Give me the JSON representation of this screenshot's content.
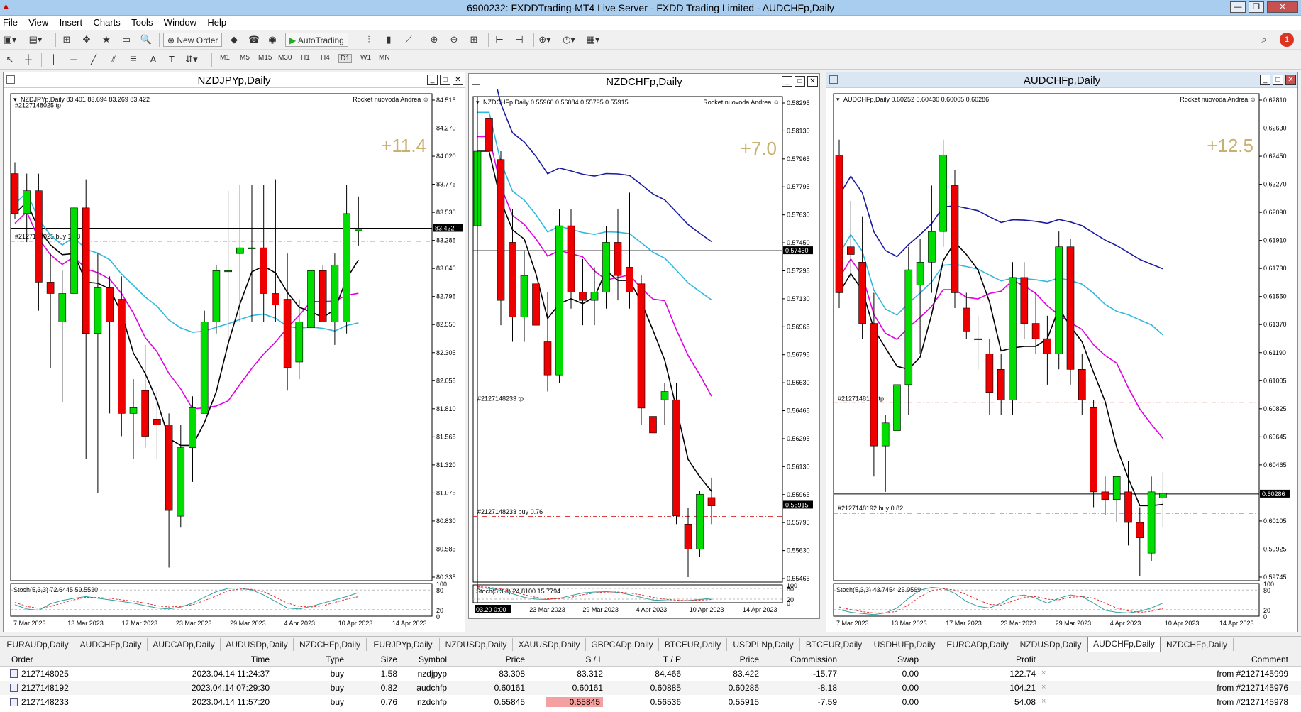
{
  "window": {
    "title": "6900232: FXDDTrading-MT4 Live Server - FXDD Trading Limited - AUDCHFp,Daily",
    "app_icon": "mt4-icon",
    "minimize_label": "—",
    "restore_label": "❐",
    "close_label": "✕"
  },
  "menu": [
    "File",
    "View",
    "Insert",
    "Charts",
    "Tools",
    "Window",
    "Help"
  ],
  "toolbar": {
    "new_order_label": "New Order",
    "autotrading_label": "AutoTrading",
    "alert_count": "1",
    "timeframes": [
      "M1",
      "M5",
      "M15",
      "M30",
      "H1",
      "H4",
      "D1",
      "W1",
      "MN"
    ],
    "selected_timeframe": "D1"
  },
  "charts": [
    {
      "id": "nzdjpy",
      "title": "NZDJPYp,Daily",
      "ohlc_label": "NZDJPYp,Daily  83.401 83.694 83.269 83.422",
      "ea_label": "Rocket nuovoda Andrea ☺",
      "pips_label": "+11.4",
      "tp_label": "#2127148025 tp",
      "buy_label": "#2127148025 buy 1.58",
      "current_price_label": "83.422",
      "price_ticks": [
        "84.515",
        "84.270",
        "84.020",
        "83.775",
        "83.530",
        "83.285",
        "83.040",
        "82.795",
        "82.550",
        "82.305",
        "82.055",
        "81.810",
        "81.565",
        "81.320",
        "81.075",
        "80.830",
        "80.585",
        "80.335"
      ],
      "stoch_label": "Stoch(5,3,3) 72.6445 59.5530",
      "stoch_ticks": [
        "100",
        "80",
        "20",
        "0"
      ],
      "date_ticks": [
        "7 Mar 2023",
        "13 Mar 2023",
        "17 Mar 2023",
        "23 Mar 2023",
        "29 Mar 2023",
        "4 Apr 2023",
        "10 Apr 2023",
        "14 Apr 2023"
      ],
      "chart_data": {
        "type": "candlestick",
        "ylim": [
          80.335,
          84.6
        ],
        "candles": [
          {
            "o": 83.9,
            "h": 84.0,
            "l": 83.5,
            "c": 83.55
          },
          {
            "o": 83.55,
            "h": 83.9,
            "l": 83.3,
            "c": 83.75
          },
          {
            "o": 83.75,
            "h": 83.9,
            "l": 82.7,
            "c": 82.95
          },
          {
            "o": 82.95,
            "h": 83.2,
            "l": 82.2,
            "c": 82.85
          },
          {
            "o": 82.6,
            "h": 83.05,
            "l": 81.9,
            "c": 82.85
          },
          {
            "o": 82.85,
            "h": 84.05,
            "l": 81.7,
            "c": 83.6
          },
          {
            "o": 83.6,
            "h": 83.85,
            "l": 81.4,
            "c": 82.5
          },
          {
            "o": 82.5,
            "h": 83.2,
            "l": 81.1,
            "c": 82.9
          },
          {
            "o": 82.9,
            "h": 83.0,
            "l": 81.8,
            "c": 82.6
          },
          {
            "o": 82.8,
            "h": 83.0,
            "l": 81.6,
            "c": 81.8
          },
          {
            "o": 81.8,
            "h": 82.1,
            "l": 81.4,
            "c": 81.85
          },
          {
            "o": 82.0,
            "h": 82.4,
            "l": 81.5,
            "c": 81.6
          },
          {
            "o": 81.75,
            "h": 82.0,
            "l": 81.4,
            "c": 81.7
          },
          {
            "o": 81.7,
            "h": 81.8,
            "l": 80.45,
            "c": 80.95
          },
          {
            "o": 80.9,
            "h": 81.7,
            "l": 80.8,
            "c": 81.5
          },
          {
            "o": 81.5,
            "h": 81.95,
            "l": 81.2,
            "c": 81.85
          },
          {
            "o": 81.8,
            "h": 82.7,
            "l": 81.8,
            "c": 82.6
          },
          {
            "o": 82.6,
            "h": 83.1,
            "l": 82.5,
            "c": 83.05
          },
          {
            "o": 83.05,
            "h": 83.75,
            "l": 82.4,
            "c": 83.05
          },
          {
            "o": 83.2,
            "h": 83.8,
            "l": 82.6,
            "c": 83.25
          },
          {
            "o": 83.25,
            "h": 83.8,
            "l": 82.6,
            "c": 83.25
          },
          {
            "o": 83.25,
            "h": 83.8,
            "l": 82.6,
            "c": 82.85
          },
          {
            "o": 82.85,
            "h": 83.85,
            "l": 82.6,
            "c": 82.75
          },
          {
            "o": 82.8,
            "h": 83.2,
            "l": 82.0,
            "c": 82.2
          },
          {
            "o": 82.25,
            "h": 82.8,
            "l": 82.1,
            "c": 82.6
          },
          {
            "o": 82.55,
            "h": 83.1,
            "l": 82.4,
            "c": 83.05
          },
          {
            "o": 83.05,
            "h": 83.1,
            "l": 82.6,
            "c": 82.6
          },
          {
            "o": 82.6,
            "h": 83.2,
            "l": 82.4,
            "c": 83.1
          },
          {
            "o": 82.6,
            "h": 83.8,
            "l": 82.5,
            "c": 83.55
          },
          {
            "o": 83.4,
            "h": 83.7,
            "l": 83.27,
            "c": 83.42
          }
        ],
        "tp_level": 84.466,
        "buy_level": 83.308,
        "current": 83.422,
        "sl_level": 83.312,
        "stoch_k": [
          35,
          22,
          18,
          38,
          48,
          55,
          60,
          55,
          50,
          45,
          40,
          32,
          25,
          22,
          28,
          40,
          58,
          75,
          85,
          86,
          80,
          65,
          45,
          25,
          22,
          30,
          40,
          50,
          60,
          72
        ],
        "stoch_d": [
          42,
          30,
          24,
          30,
          40,
          50,
          58,
          57,
          55,
          50,
          46,
          40,
          32,
          28,
          30,
          35,
          48,
          62,
          78,
          83,
          82,
          75,
          58,
          40,
          30,
          28,
          32,
          42,
          52,
          60
        ]
      }
    },
    {
      "id": "nzdchf",
      "title": "NZDCHFp,Daily",
      "ohlc_label": "NZDCHFp,Daily  0.55960 0.56084 0.55795 0.55915",
      "ea_label": "Rocket nuovoda Andrea ☺",
      "pips_label": "+7.0",
      "tp_label": "#2127148233 tp",
      "buy_label": "#2127148233 buy 0.76",
      "current_price_label": "0.55915",
      "line_price_label": "0.57450",
      "price_ticks": [
        "0.58295",
        "0.58130",
        "0.57965",
        "0.57795",
        "0.57630",
        "0.57450",
        "0.57295",
        "0.57130",
        "0.56965",
        "0.56795",
        "0.56630",
        "0.56465",
        "0.56295",
        "0.56130",
        "0.55965",
        "0.55795",
        "0.55630",
        "0.55465"
      ],
      "stoch_label": "Stoch(5,3,3) 24.8100 15.7794",
      "stoch_ticks": [
        "100",
        "80",
        "20",
        "0"
      ],
      "date_ticks": [
        "03.20 0:00",
        "23 Mar 2023",
        "29 Mar 2023",
        "4 Apr 2023",
        "10 Apr 2023",
        "14 Apr 2023"
      ],
      "chart_data": {
        "type": "candlestick",
        "ylim": [
          0.5545,
          0.5838
        ],
        "candles": [
          {
            "o": 0.576,
            "h": 0.582,
            "l": 0.575,
            "c": 0.5805
          },
          {
            "o": 0.5825,
            "h": 0.583,
            "l": 0.579,
            "c": 0.5805
          },
          {
            "o": 0.58,
            "h": 0.5805,
            "l": 0.57,
            "c": 0.5715
          },
          {
            "o": 0.575,
            "h": 0.577,
            "l": 0.569,
            "c": 0.5705
          },
          {
            "o": 0.5705,
            "h": 0.5745,
            "l": 0.569,
            "c": 0.573
          },
          {
            "o": 0.5725,
            "h": 0.576,
            "l": 0.569,
            "c": 0.57
          },
          {
            "o": 0.569,
            "h": 0.572,
            "l": 0.566,
            "c": 0.567
          },
          {
            "o": 0.567,
            "h": 0.577,
            "l": 0.5665,
            "c": 0.576
          },
          {
            "o": 0.576,
            "h": 0.577,
            "l": 0.571,
            "c": 0.572
          },
          {
            "o": 0.572,
            "h": 0.574,
            "l": 0.57,
            "c": 0.5715
          },
          {
            "o": 0.5715,
            "h": 0.5735,
            "l": 0.57,
            "c": 0.572
          },
          {
            "o": 0.572,
            "h": 0.576,
            "l": 0.571,
            "c": 0.575
          },
          {
            "o": 0.575,
            "h": 0.577,
            "l": 0.5715,
            "c": 0.573
          },
          {
            "o": 0.5735,
            "h": 0.578,
            "l": 0.571,
            "c": 0.572
          },
          {
            "o": 0.5725,
            "h": 0.573,
            "l": 0.564,
            "c": 0.565
          },
          {
            "o": 0.5645,
            "h": 0.566,
            "l": 0.563,
            "c": 0.5635
          },
          {
            "o": 0.5655,
            "h": 0.5665,
            "l": 0.564,
            "c": 0.566
          },
          {
            "o": 0.5655,
            "h": 0.5665,
            "l": 0.558,
            "c": 0.5585
          },
          {
            "o": 0.558,
            "h": 0.559,
            "l": 0.5548,
            "c": 0.5565
          },
          {
            "o": 0.5565,
            "h": 0.56,
            "l": 0.556,
            "c": 0.5598
          },
          {
            "o": 0.5596,
            "h": 0.5608,
            "l": 0.558,
            "c": 0.5591
          }
        ],
        "tp_level": 0.56536,
        "buy_level": 0.55845,
        "current": 0.55915,
        "black_line": 0.5745,
        "stoch_k": [
          85,
          80,
          70,
          50,
          30,
          20,
          18,
          25,
          40,
          55,
          60,
          62,
          58,
          45,
          30,
          15,
          12,
          10,
          12,
          18,
          25
        ],
        "stoch_d": [
          90,
          86,
          78,
          62,
          45,
          30,
          22,
          22,
          30,
          45,
          55,
          60,
          60,
          54,
          44,
          30,
          20,
          14,
          12,
          14,
          18
        ]
      }
    },
    {
      "id": "audchf",
      "title": "AUDCHFp,Daily",
      "ohlc_label": "AUDCHFp,Daily  0.60252 0.60430 0.60065 0.60286",
      "ea_label": "Rocket nuovoda Andrea ☺",
      "pips_label": "+12.5",
      "tp_label": "#2127148192 tp",
      "buy_label": "#2127148192 buy 0.82",
      "current_price_label": "0.60286",
      "price_ticks": [
        "0.62810",
        "0.62630",
        "0.62450",
        "0.62270",
        "0.62090",
        "0.61910",
        "0.61730",
        "0.61550",
        "0.61370",
        "0.61190",
        "0.61005",
        "0.60825",
        "0.60645",
        "0.60465",
        "0.60285",
        "0.60105",
        "0.59925",
        "0.59745"
      ],
      "stoch_label": "Stoch(5,3,3) 43.7454 25.9569",
      "stoch_ticks": [
        "100",
        "80",
        "20",
        "0"
      ],
      "date_ticks": [
        "7 Mar 2023",
        "13 Mar 2023",
        "17 Mar 2023",
        "23 Mar 2023",
        "29 Mar 2023",
        "4 Apr 2023",
        "10 Apr 2023",
        "14 Apr 2023"
      ],
      "chart_data": {
        "type": "candlestick",
        "ylim": [
          0.5972,
          0.629
        ],
        "candles": [
          {
            "o": 0.625,
            "h": 0.626,
            "l": 0.615,
            "c": 0.616
          },
          {
            "o": 0.619,
            "h": 0.622,
            "l": 0.617,
            "c": 0.6185
          },
          {
            "o": 0.618,
            "h": 0.621,
            "l": 0.613,
            "c": 0.614
          },
          {
            "o": 0.614,
            "h": 0.616,
            "l": 0.604,
            "c": 0.606
          },
          {
            "o": 0.606,
            "h": 0.608,
            "l": 0.603,
            "c": 0.6075
          },
          {
            "o": 0.607,
            "h": 0.611,
            "l": 0.604,
            "c": 0.61
          },
          {
            "o": 0.61,
            "h": 0.619,
            "l": 0.608,
            "c": 0.6175
          },
          {
            "o": 0.6165,
            "h": 0.6195,
            "l": 0.612,
            "c": 0.618
          },
          {
            "o": 0.618,
            "h": 0.623,
            "l": 0.616,
            "c": 0.62
          },
          {
            "o": 0.62,
            "h": 0.626,
            "l": 0.619,
            "c": 0.625
          },
          {
            "o": 0.623,
            "h": 0.624,
            "l": 0.615,
            "c": 0.616
          },
          {
            "o": 0.615,
            "h": 0.616,
            "l": 0.613,
            "c": 0.6135
          },
          {
            "o": 0.613,
            "h": 0.6145,
            "l": 0.611,
            "c": 0.613
          },
          {
            "o": 0.612,
            "h": 0.613,
            "l": 0.608,
            "c": 0.6095
          },
          {
            "o": 0.611,
            "h": 0.612,
            "l": 0.608,
            "c": 0.609
          },
          {
            "o": 0.609,
            "h": 0.618,
            "l": 0.608,
            "c": 0.617
          },
          {
            "o": 0.617,
            "h": 0.618,
            "l": 0.613,
            "c": 0.614
          },
          {
            "o": 0.614,
            "h": 0.616,
            "l": 0.612,
            "c": 0.613
          },
          {
            "o": 0.613,
            "h": 0.6145,
            "l": 0.61,
            "c": 0.612
          },
          {
            "o": 0.612,
            "h": 0.62,
            "l": 0.611,
            "c": 0.619
          },
          {
            "o": 0.619,
            "h": 0.6195,
            "l": 0.61,
            "c": 0.611
          },
          {
            "o": 0.611,
            "h": 0.612,
            "l": 0.608,
            "c": 0.609
          },
          {
            "o": 0.6085,
            "h": 0.609,
            "l": 0.602,
            "c": 0.603
          },
          {
            "o": 0.603,
            "h": 0.604,
            "l": 0.6015,
            "c": 0.6025
          },
          {
            "o": 0.6025,
            "h": 0.604,
            "l": 0.601,
            "c": 0.604
          },
          {
            "o": 0.603,
            "h": 0.605,
            "l": 0.5995,
            "c": 0.601
          },
          {
            "o": 0.601,
            "h": 0.602,
            "l": 0.5975,
            "c": 0.6
          },
          {
            "o": 0.599,
            "h": 0.604,
            "l": 0.5985,
            "c": 0.603
          },
          {
            "o": 0.6026,
            "h": 0.6043,
            "l": 0.6007,
            "c": 0.6029
          }
        ],
        "tp_level": 0.60885,
        "buy_level": 0.60161,
        "current": 0.60286,
        "stoch_k": [
          20,
          12,
          8,
          5,
          10,
          25,
          55,
          80,
          88,
          85,
          70,
          45,
          30,
          25,
          40,
          60,
          65,
          55,
          40,
          55,
          65,
          60,
          40,
          18,
          12,
          10,
          15,
          25,
          40
        ],
        "stoch_d": [
          28,
          20,
          14,
          10,
          10,
          15,
          35,
          60,
          78,
          84,
          80,
          66,
          50,
          36,
          34,
          46,
          58,
          60,
          52,
          50,
          58,
          60,
          55,
          40,
          25,
          16,
          12,
          15,
          24
        ]
      }
    }
  ],
  "tabs": [
    "EURAUDp,Daily",
    "AUDCHFp,Daily",
    "AUDCADp,Daily",
    "AUDUSDp,Daily",
    "NZDCHFp,Daily",
    "EURJPYp,Daily",
    "NZDUSDp,Daily",
    "XAUUSDp,Daily",
    "GBPCADp,Daily",
    "BTCEUR,Daily",
    "USDPLNp,Daily",
    "BTCEUR,Daily",
    "USDHUFp,Daily",
    "EURCADp,Daily",
    "NZDUSDp,Daily",
    "AUDCHFp,Daily",
    "NZDCHFp,Daily"
  ],
  "active_tab_index": 15,
  "terminal": {
    "headers": {
      "order": "Order",
      "time": "Time",
      "type": "Type",
      "size": "Size",
      "symbol": "Symbol",
      "price": "Price",
      "sl": "S / L",
      "tp": "T / P",
      "cur_price": "Price",
      "commission": "Commission",
      "swap": "Swap",
      "profit": "Profit",
      "comment": "Comment"
    },
    "rows": [
      {
        "order": "2127148025",
        "time": "2023.04.14 11:24:37",
        "type": "buy",
        "size": "1.58",
        "symbol": "nzdjpyp",
        "price": "83.308",
        "sl": "83.312",
        "tp": "84.466",
        "cur_price": "83.422",
        "commission": "-15.77",
        "swap": "0.00",
        "profit": "122.74",
        "comment": "from #2127145999"
      },
      {
        "order": "2127148192",
        "time": "2023.04.14 07:29:30",
        "type": "buy",
        "size": "0.82",
        "symbol": "audchfp",
        "price": "0.60161",
        "sl": "0.60161",
        "tp": "0.60885",
        "cur_price": "0.60286",
        "commission": "-8.18",
        "swap": "0.00",
        "profit": "104.21",
        "comment": "from #2127145976"
      },
      {
        "order": "2127148233",
        "time": "2023.04.14 11:57:20",
        "type": "buy",
        "size": "0.76",
        "symbol": "nzdchfp",
        "price": "0.55845",
        "sl": "0.55845",
        "tp": "0.56536",
        "cur_price": "0.55915",
        "commission": "-7.59",
        "swap": "0.00",
        "profit": "54.08",
        "comment": "from #2127145978"
      }
    ],
    "close_mark": "×"
  },
  "colors": {
    "bull": "#00dd00",
    "bear": "#ee0000",
    "ma_fast": "#000000",
    "ma_mid": "#e000e0",
    "ma_slow": "#30b8e0",
    "ma_long": "#1a1aa0",
    "level_line": "#cc0000",
    "pips": "#c8b070",
    "sl_highlight": "#f4a0a0"
  }
}
